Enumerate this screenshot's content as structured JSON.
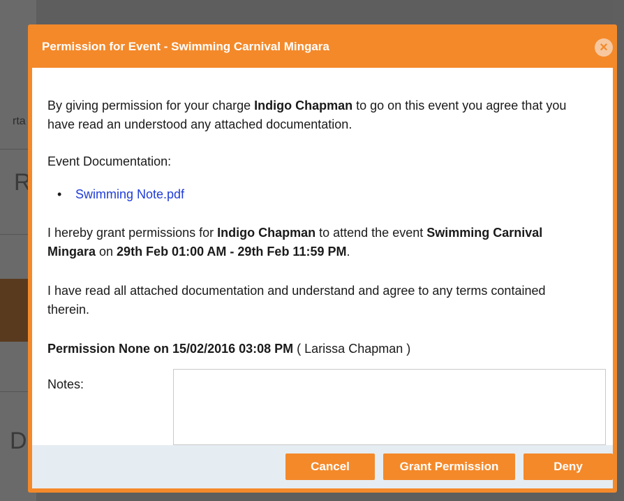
{
  "background": {
    "fragment_1": "rta",
    "fragment_2": "RC",
    "fragment_3": "D"
  },
  "dialog": {
    "title": "Permission for Event - Swimming Carnival Mingara",
    "close_icon": "×",
    "intro": {
      "prefix": "By giving permission for your charge ",
      "name": "Indigo Chapman",
      "suffix": " to go on this event you agree that you have read an understood any attached documentation."
    },
    "documentation_label": "Event Documentation:",
    "documents": [
      "Swimming Note.pdf"
    ],
    "grant": {
      "prefix": "I hereby grant permissions for ",
      "name": "Indigo Chapman",
      "middle": " to attend the event ",
      "event": "Swimming Carnival Mingara",
      "on": " on ",
      "dates": "29th Feb 01:00 AM - 29th Feb 11:59 PM",
      "end": "."
    },
    "agreement": "I have read all attached documentation and understand and agree to any terms contained therein.",
    "status": {
      "label": "Permission None on 15/02/2016 03:08 PM",
      "by": " ( Larissa Chapman )"
    },
    "notes_label": "Notes:",
    "notes_value": "",
    "buttons": {
      "cancel": "Cancel",
      "grant": "Grant Permission",
      "deny": "Deny"
    }
  },
  "colors": {
    "accent": "#f4892a",
    "link": "#1f3cd6",
    "footer": "#e6edf2"
  }
}
